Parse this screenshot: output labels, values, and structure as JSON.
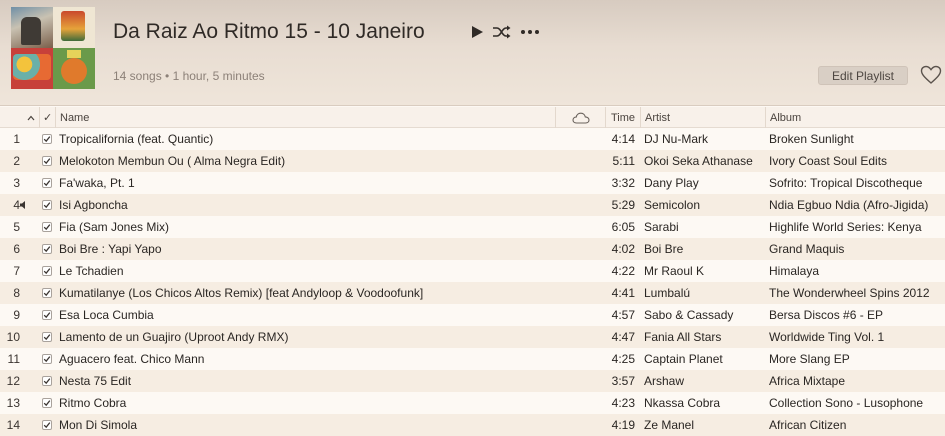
{
  "playlist": {
    "title": "Da Raiz Ao Ritmo 15 - 10 Janeiro",
    "meta": "14 songs • 1 hour, 5 minutes",
    "edit_label": "Edit Playlist"
  },
  "icons": {
    "play": "play-icon",
    "shuffle": "shuffle-icon",
    "more": "more-icon",
    "heart": "heart-icon",
    "cloud": "cloud-icon",
    "sort": "sort-ascending-icon",
    "speaker": "speaker-icon"
  },
  "columns": {
    "check": "✓",
    "name": "Name",
    "time": "Time",
    "artist": "Artist",
    "album": "Album"
  },
  "now_playing_index": 4,
  "tracks": [
    {
      "num": "1",
      "name": "Tropicalifornia (feat. Quantic)",
      "time": "4:14",
      "artist": "DJ Nu-Mark",
      "album": "Broken Sunlight"
    },
    {
      "num": "2",
      "name": "Melokoton Membun Ou ( Alma Negra Edit)",
      "time": "5:11",
      "artist": "Okoi Seka Athanase",
      "album": "Ivory Coast Soul Edits"
    },
    {
      "num": "3",
      "name": "Fa'waka, Pt. 1",
      "time": "3:32",
      "artist": "Dany Play",
      "album": "Sofrito: Tropical Discotheque"
    },
    {
      "num": "4",
      "name": "Isi Agboncha",
      "time": "5:29",
      "artist": "Semicolon",
      "album": "Ndia Egbuo Ndia (Afro-Jigida)"
    },
    {
      "num": "5",
      "name": "Fia (Sam Jones Mix)",
      "time": "6:05",
      "artist": "Sarabi",
      "album": "Highlife World Series: Kenya"
    },
    {
      "num": "6",
      "name": "Boi Bre : Yapi Yapo",
      "time": "4:02",
      "artist": "Boi Bre",
      "album": "Grand Maquis"
    },
    {
      "num": "7",
      "name": "Le Tchadien",
      "time": "4:22",
      "artist": "Mr Raoul K",
      "album": "Himalaya"
    },
    {
      "num": "8",
      "name": "Kumatilanye (Los Chicos Altos Remix) [feat Andyloop & Voodoofunk]",
      "time": "4:41",
      "artist": "Lumbalú",
      "album": "The Wonderwheel Spins 2012"
    },
    {
      "num": "9",
      "name": "Esa Loca Cumbia",
      "time": "4:57",
      "artist": "Sabo & Cassady",
      "album": "Bersa Discos #6 - EP"
    },
    {
      "num": "10",
      "name": "Lamento de un Guajiro (Uproot Andy RMX)",
      "time": "4:47",
      "artist": "Fania All Stars",
      "album": "Worldwide Ting Vol. 1"
    },
    {
      "num": "11",
      "name": "Aguacero feat. Chico  Mann",
      "time": "4:25",
      "artist": "Captain Planet",
      "album": "More Slang EP"
    },
    {
      "num": "12",
      "name": "Nesta 75 Edit",
      "time": "3:57",
      "artist": "Arshaw",
      "album": "Africa Mixtape"
    },
    {
      "num": "13",
      "name": "Ritmo Cobra",
      "time": "4:23",
      "artist": "Nkassa Cobra",
      "album": "Collection Sono - Lusophone"
    },
    {
      "num": "14",
      "name": "Mon Di Simola",
      "time": "4:19",
      "artist": "Ze Manel",
      "album": "African Citizen"
    }
  ]
}
